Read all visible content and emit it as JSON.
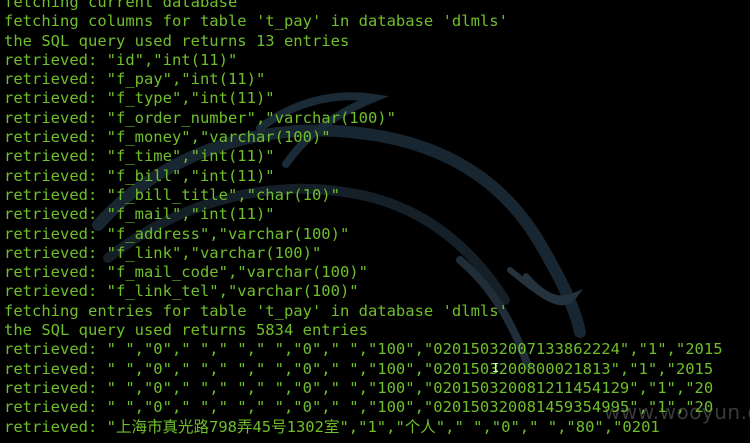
{
  "terminal": {
    "lines": [
      "fetching current database",
      "fetching columns for table 't_pay' in database 'dlmls'",
      "the SQL query used returns 13 entries",
      "retrieved: \"id\",\"int(11)\"",
      "retrieved: \"f_pay\",\"int(11)\"",
      "retrieved: \"f_type\",\"int(11)\"",
      "retrieved: \"f_order_number\",\"varchar(100)\"",
      "retrieved: \"f_money\",\"varchar(100)\"",
      "retrieved: \"f_time\",\"int(11)\"",
      "retrieved: \"f_bill\",\"int(11)\"",
      "retrieved: \"f_bill_title\",\"char(10)\"",
      "retrieved: \"f_mail\",\"int(11)\"",
      "retrieved: \"f_address\",\"varchar(100)\"",
      "retrieved: \"f_link\",\"varchar(100)\"",
      "retrieved: \"f_mail_code\",\"varchar(100)\"",
      "retrieved: \"f_link_tel\",\"varchar(100)\"",
      "fetching entries for table 't_pay' in database 'dlmls'",
      "the SQL query used returns 5834 entries",
      "retrieved: \" \",\"0\",\" \",\" \",\" \",\"0\",\" \",\"100\",\"020150320071338622​24\",\"1\",\"2015",
      "retrieved: \" \",\"0\",\" \",\" \",\" \",\"0\",\" \",\"100\",\"02015032008000218​13\",\"1\",\"2015",
      "retrieved: \" \",\"0\",\" \",\" \",\" \",\"0\",\" \",\"100\",\"020150320081211454​129\",\"1\",\"20",
      "retrieved: \" \",\"0\",\" \",\" \",\" \",\"0\",\" \",\"100\",\"020150320081459354995\",\"1\",\"20",
      "retrieved: \"上海市真光路798弄45号1302室\",\"1\",\"个人\",\" \",\"0\",\" \",\"80\",\"0201"
    ]
  },
  "watermark": {
    "text": "www.wooyun.org"
  },
  "colors": {
    "text": "#6fbf2a",
    "background": "#000000"
  },
  "icons": {
    "background_logo": "kali-dragon-icon",
    "cursor": "text-cursor-icon"
  }
}
